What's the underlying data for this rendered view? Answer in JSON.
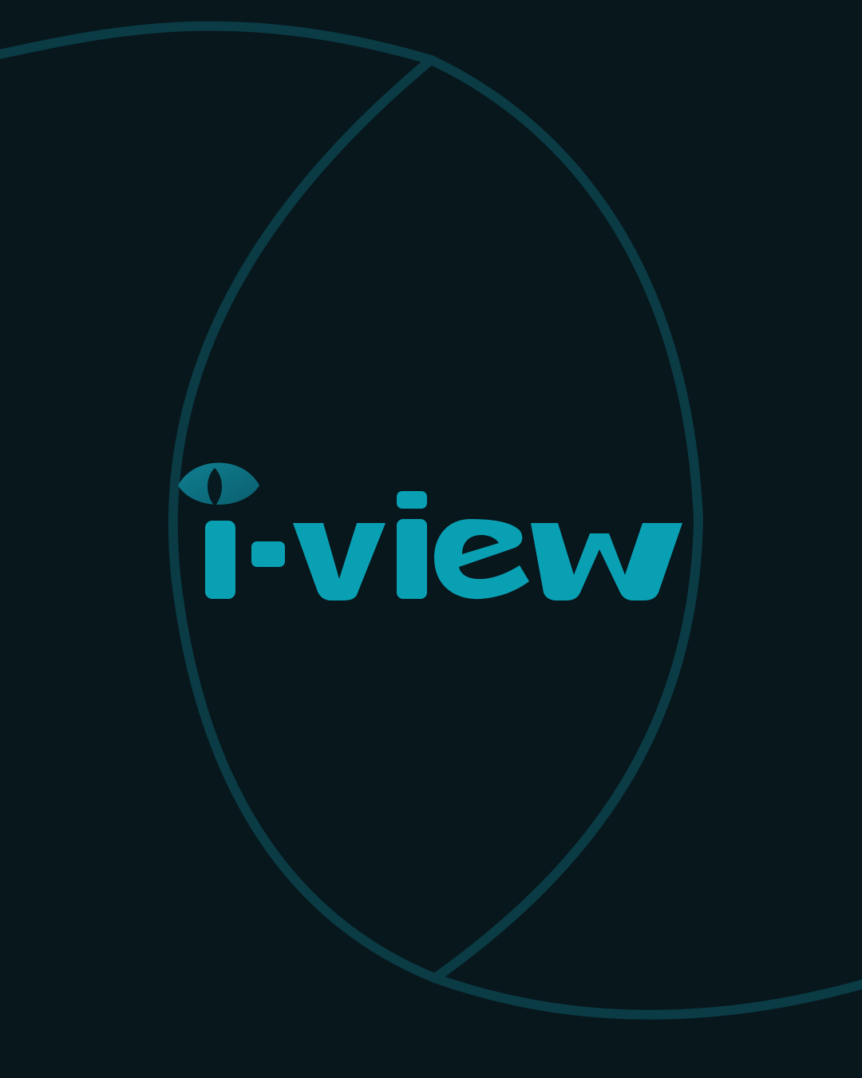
{
  "brand": {
    "wordmark": "i-view",
    "accent_color": "#0aa0b4",
    "eye_color": "#0f7f91",
    "pupil_color": "#061a20"
  },
  "background": {
    "color": "#07171c",
    "line_color": "#0b3b45"
  },
  "icons": {
    "logo_mark": "eye-icon"
  }
}
